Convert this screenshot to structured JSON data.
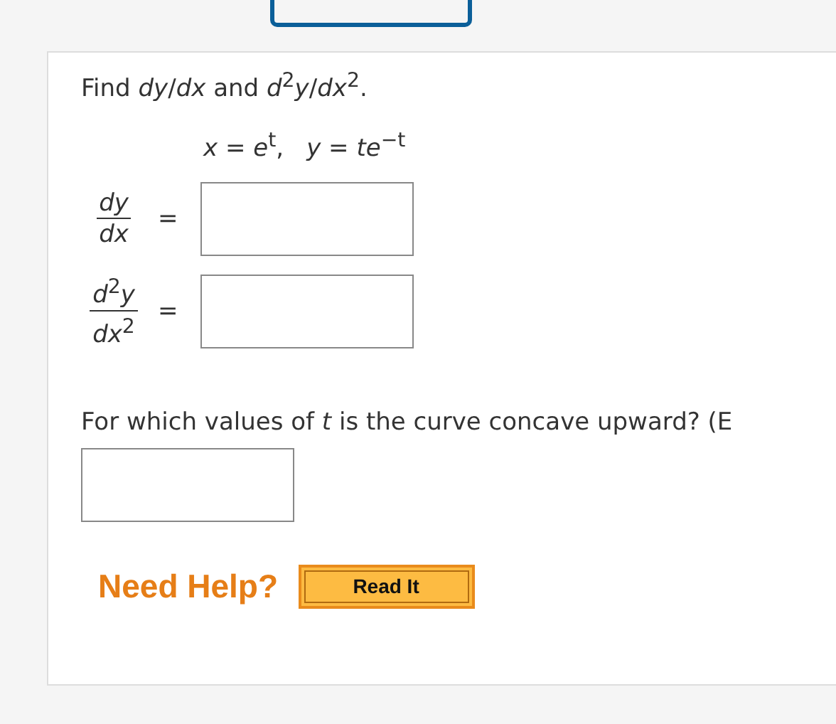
{
  "prompt": "Find *dy*/*dx* and *d*$^{2}$*y*/*dx*$^{2}$.",
  "equations": [
    "*x* = *e*$^{t}$,",
    "*y* = *te*$^{−t}$"
  ],
  "answers": [
    {
      "numerator": "*dy*",
      "denominator": "*dx*",
      "sign": "="
    },
    {
      "numerator": "*d*$^{2}$*y*",
      "denominator": "*dx*$^{2}$",
      "sign": "="
    }
  ],
  "question": "For which values of *t* is the curve concave upward? (E",
  "help": {
    "label": "Need Help?",
    "buttons": [
      "Read It"
    ]
  }
}
